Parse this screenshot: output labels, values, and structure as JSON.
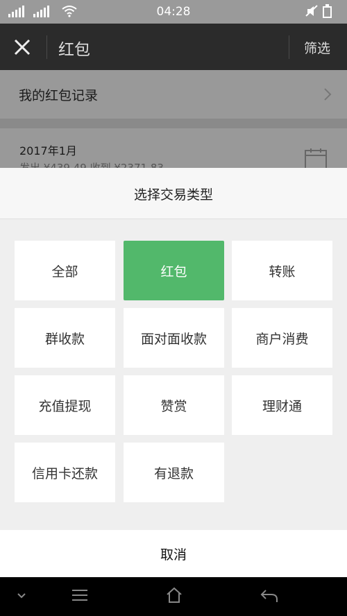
{
  "status_bar": {
    "time": "04:28",
    "signal_icons": [
      "signal-icon",
      "signal-icon",
      "wifi-icon",
      "mute-icon",
      "battery-icon"
    ]
  },
  "title_bar": {
    "title": "红包",
    "filter_label": "筛选",
    "close_icon": "close-icon"
  },
  "background": {
    "records_label": "我的红包记录",
    "month": "2017年1月",
    "summary": "发出 ¥439.49 收到 ¥2371.83"
  },
  "sheet": {
    "title": "选择交易类型",
    "options": [
      {
        "label": "全部",
        "selected": false
      },
      {
        "label": "红包",
        "selected": true
      },
      {
        "label": "转账",
        "selected": false
      },
      {
        "label": "群收款",
        "selected": false
      },
      {
        "label": "面对面收款",
        "selected": false
      },
      {
        "label": "商户消费",
        "selected": false
      },
      {
        "label": "充值提现",
        "selected": false
      },
      {
        "label": "赞赏",
        "selected": false
      },
      {
        "label": "理财通",
        "selected": false
      },
      {
        "label": "信用卡还款",
        "selected": false
      },
      {
        "label": "有退款",
        "selected": false
      }
    ],
    "cancel_label": "取消"
  },
  "colors": {
    "accent": "#52b86b",
    "titlebar": "#2b2b2b",
    "overlay": "#999999"
  }
}
